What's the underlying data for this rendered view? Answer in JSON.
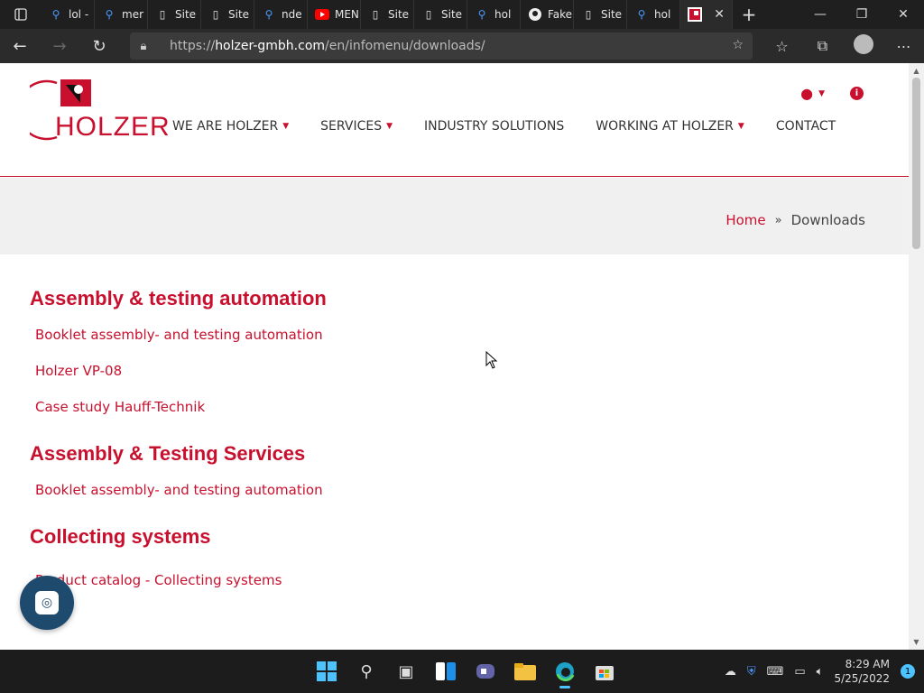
{
  "browser": {
    "tabs": [
      {
        "label": "lol -",
        "icon": "search-icon"
      },
      {
        "label": "mer",
        "icon": "search-icon"
      },
      {
        "label": "Site",
        "icon": "page-icon"
      },
      {
        "label": "Site",
        "icon": "page-icon"
      },
      {
        "label": "nde",
        "icon": "search-icon"
      },
      {
        "label": "MEN",
        "icon": "youtube-icon"
      },
      {
        "label": "Site",
        "icon": "page-icon"
      },
      {
        "label": "Site",
        "icon": "page-icon"
      },
      {
        "label": "hol",
        "icon": "search-icon"
      },
      {
        "label": "Fake",
        "icon": "github-icon"
      },
      {
        "label": "Site",
        "icon": "page-icon"
      },
      {
        "label": "hol",
        "icon": "search-icon"
      }
    ],
    "address": {
      "prefix": "https://",
      "domain": "holzer-gmbh.com",
      "path": "/en/infomenu/downloads/"
    }
  },
  "site": {
    "logo_text": "HOLZER",
    "nav": [
      {
        "label": "WE ARE HOLZER",
        "dropdown": true
      },
      {
        "label": "SERVICES",
        "dropdown": true
      },
      {
        "label": "INDUSTRY SOLUTIONS",
        "dropdown": false
      },
      {
        "label": "WORKING AT HOLZER",
        "dropdown": true
      },
      {
        "label": "CONTACT",
        "dropdown": false
      }
    ],
    "breadcrumb": {
      "home": "Home",
      "current": "Downloads"
    },
    "sections": [
      {
        "title": "Assembly & testing automation",
        "links": [
          "Booklet assembly- and testing automation",
          "Holzer VP-08",
          "Case study Hauff-Technik"
        ]
      },
      {
        "title": "Assembly & Testing Services",
        "links": [
          "Booklet assembly- and testing automation"
        ]
      },
      {
        "title": "Collecting systems",
        "links": [
          "Product catalog - Collecting systems"
        ]
      }
    ],
    "accent_color": "#c8102e"
  },
  "taskbar": {
    "time": "8:29 AM",
    "date": "5/25/2022",
    "notifications": "1"
  }
}
